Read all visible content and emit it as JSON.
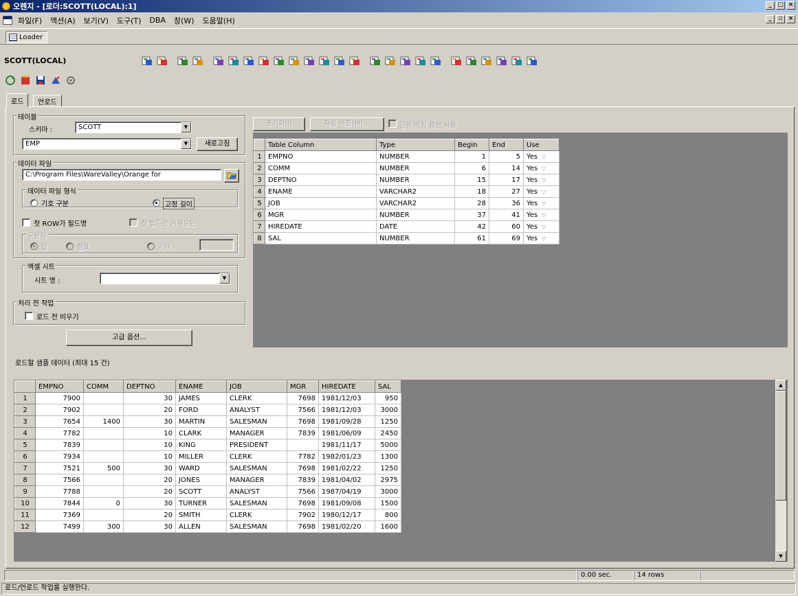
{
  "window": {
    "title": "오렌지 - [로더:SCOTT(LOCAL):1]"
  },
  "menu": [
    "파일(F)",
    "액션(A)",
    "보기(V)",
    "도구(T)",
    "DBA",
    "창(W)",
    "도움말(H)"
  ],
  "window_tab": "Loader",
  "connection": "SCOTT(LOCAL)",
  "tabs": [
    "로드",
    "언로드"
  ],
  "table_group": {
    "title": "테이블",
    "schema_label": "스키마 :",
    "schema_value": "SCOTT",
    "table_value": "EMP",
    "refresh_label": "새로고침"
  },
  "data_file": {
    "title": "데이터 파일",
    "path": "C:\\Program Files\\WareValley\\Orange for",
    "format_title": "데이터 파일 형식",
    "opt_delimited": "기호 구분",
    "opt_fixed": "고정 길이",
    "first_row_label": "첫 ROW가 필드명",
    "first_row_disabled": "첫 필드만 가져오는",
    "delim_title": "구분자",
    "delim_tab": "탭",
    "delim_comma": "쉼표",
    "delim_other": "기타"
  },
  "excel": {
    "title": "엑셀 시트",
    "sheet_label": "시트 명 :",
    "sheet_value": ""
  },
  "pre": {
    "title": "처리 전 작업",
    "clear_label": "로드 전 비우기"
  },
  "advanced_button": "고급 옵션...",
  "sample_label": "로드할 샘플 데이터 (최대 15 건)",
  "map_toolbar": {
    "btn1": "초기화(I)",
    "btn2": "자동 매핑(M)...",
    "chk_label": "단위 매핑 옵션 사용"
  },
  "mapping": {
    "headers": [
      "Table Column",
      "Type",
      "Begin",
      "End",
      "Use"
    ],
    "rows": [
      [
        "1",
        "EMPNO",
        "NUMBER",
        "1",
        "5",
        "Yes"
      ],
      [
        "2",
        "COMM",
        "NUMBER",
        "6",
        "14",
        "Yes"
      ],
      [
        "3",
        "DEPTNO",
        "NUMBER",
        "15",
        "17",
        "Yes"
      ],
      [
        "4",
        "ENAME",
        "VARCHAR2",
        "18",
        "27",
        "Yes"
      ],
      [
        "5",
        "JOB",
        "VARCHAR2",
        "28",
        "36",
        "Yes"
      ],
      [
        "6",
        "MGR",
        "NUMBER",
        "37",
        "41",
        "Yes"
      ],
      [
        "7",
        "HIREDATE",
        "DATE",
        "42",
        "60",
        "Yes"
      ],
      [
        "8",
        "SAL",
        "NUMBER",
        "61",
        "69",
        "Yes"
      ]
    ]
  },
  "sample": {
    "headers": [
      "EMPNO",
      "COMM",
      "DEPTNO",
      "ENAME",
      "JOB",
      "MGR",
      "HIREDATE",
      "SAL"
    ],
    "rows": [
      [
        "1",
        "7900",
        "",
        "30",
        "JAMES",
        "CLERK",
        "7698",
        "1981/12/03",
        "950"
      ],
      [
        "2",
        "7902",
        "",
        "20",
        "FORD",
        "ANALYST",
        "7566",
        "1981/12/03",
        "3000"
      ],
      [
        "3",
        "7654",
        "1400",
        "30",
        "MARTIN",
        "SALESMAN",
        "7698",
        "1981/09/28",
        "1250"
      ],
      [
        "4",
        "7782",
        "",
        "10",
        "CLARK",
        "MANAGER",
        "7839",
        "1981/06/09",
        "2450"
      ],
      [
        "5",
        "7839",
        "",
        "10",
        "KING",
        "PRESIDENT",
        "",
        "1981/11/17",
        "5000"
      ],
      [
        "6",
        "7934",
        "",
        "10",
        "MILLER",
        "CLERK",
        "7782",
        "1982/01/23",
        "1300"
      ],
      [
        "7",
        "7521",
        "500",
        "30",
        "WARD",
        "SALESMAN",
        "7698",
        "1981/02/22",
        "1250"
      ],
      [
        "8",
        "7566",
        "",
        "20",
        "JONES",
        "MANAGER",
        "7839",
        "1981/04/02",
        "2975"
      ],
      [
        "9",
        "7788",
        "",
        "20",
        "SCOTT",
        "ANALYST",
        "7566",
        "1987/04/19",
        "3000"
      ],
      [
        "10",
        "7844",
        "0",
        "30",
        "TURNER",
        "SALESMAN",
        "7698",
        "1981/09/08",
        "1500"
      ],
      [
        "11",
        "7369",
        "",
        "20",
        "SMITH",
        "CLERK",
        "7902",
        "1980/12/17",
        "800"
      ],
      [
        "12",
        "7499",
        "300",
        "30",
        "ALLEN",
        "SALESMAN",
        "7698",
        "1981/02/20",
        "1600"
      ]
    ]
  },
  "status": {
    "time": "0.00 sec.",
    "rows": "14 rows",
    "message": "로드/언로드 작업를 실행한다."
  },
  "toolbar_icons": [
    "run-icon",
    "run-step-icon",
    "indent-icon",
    "outdent-icon",
    "explain-plan-icon",
    "trace-icon",
    "schema-browser-icon",
    "table-icon",
    "sql-icon",
    "query-builder-icon",
    "data-icon",
    "loader-icon",
    "chart-icon",
    "export-icon",
    "import-icon",
    "session-icon",
    "lock-icon",
    "db-icon",
    "users-icon",
    "role-icon",
    "storage-icon",
    "monitor-icon",
    "tuning-icon",
    "report-icon",
    "help-icon"
  ]
}
